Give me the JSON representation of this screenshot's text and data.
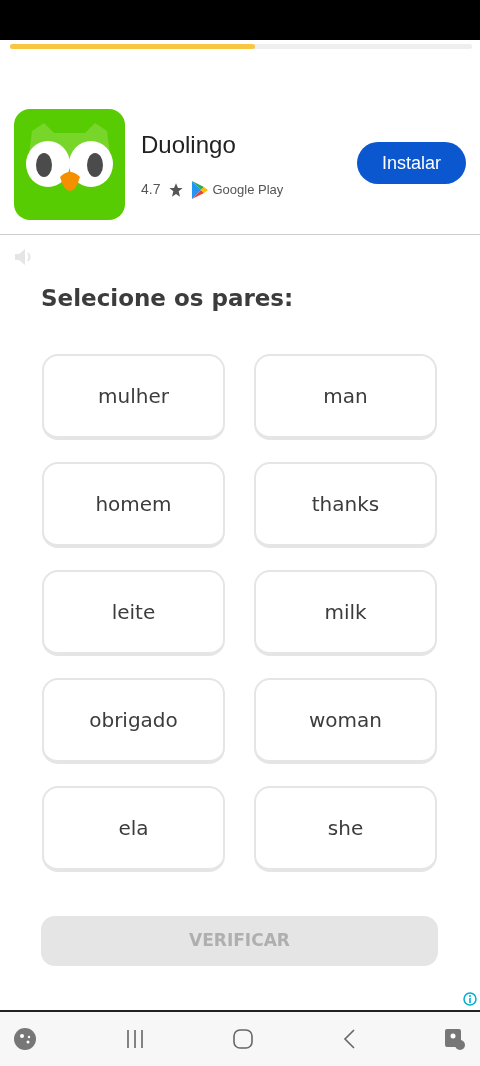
{
  "progress": {
    "level": 0.53
  },
  "ad": {
    "app_name": "Duolingo",
    "rating": "4.7",
    "store": "Google Play",
    "button": "Instalar"
  },
  "title": "Selecione os pares:",
  "tiles": [
    {
      "text": "mulher"
    },
    {
      "text": "man"
    },
    {
      "text": "homem"
    },
    {
      "text": "thanks"
    },
    {
      "text": "leite"
    },
    {
      "text": "milk"
    },
    {
      "text": "obrigado"
    },
    {
      "text": "woman"
    },
    {
      "text": "ela"
    },
    {
      "text": "she"
    }
  ],
  "verify_button": {
    "label": "VERIFICAR",
    "disabled": true
  }
}
